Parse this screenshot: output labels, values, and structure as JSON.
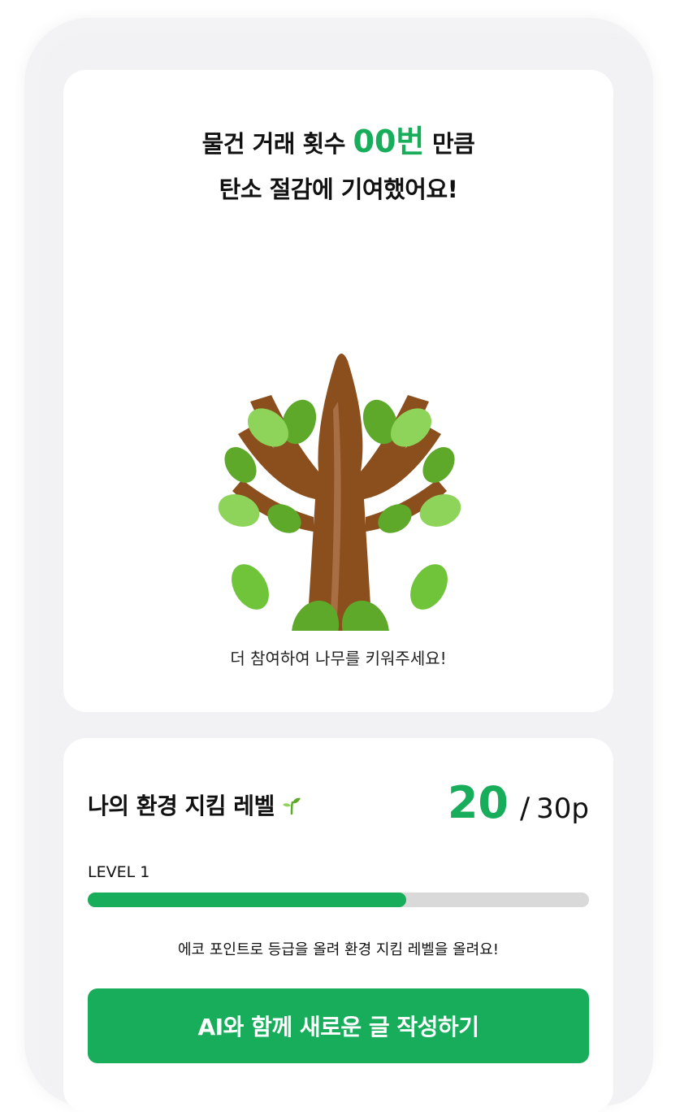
{
  "headline": {
    "line1_prefix": "물건 거래 횟수",
    "count": "00번",
    "line1_suffix": "만큼",
    "line2": "탄소 절감에 기여했어요!"
  },
  "tree": {
    "caption": "더 참여하여 나무를 키워주세요!",
    "icon": "tree-icon"
  },
  "level": {
    "title": "나의 환경 지킴 레벨",
    "icon": "sprout-icon",
    "points_current": "20",
    "points_separator": "/",
    "points_goal": "30p",
    "level_label": "LEVEL 1",
    "progress_fraction": 0.635,
    "caption": "에코 포인트로 등급을 올려 환경 지킴 레벨을 올려요!",
    "cta_label": "AI와 함께 새로운 글 작성하기"
  },
  "colors": {
    "accent": "#17ad5b",
    "track": "#d9d9d9",
    "trunk": "#8b4f1d",
    "leaf_light": "#8ed45a",
    "leaf_dark": "#5ea92a"
  }
}
